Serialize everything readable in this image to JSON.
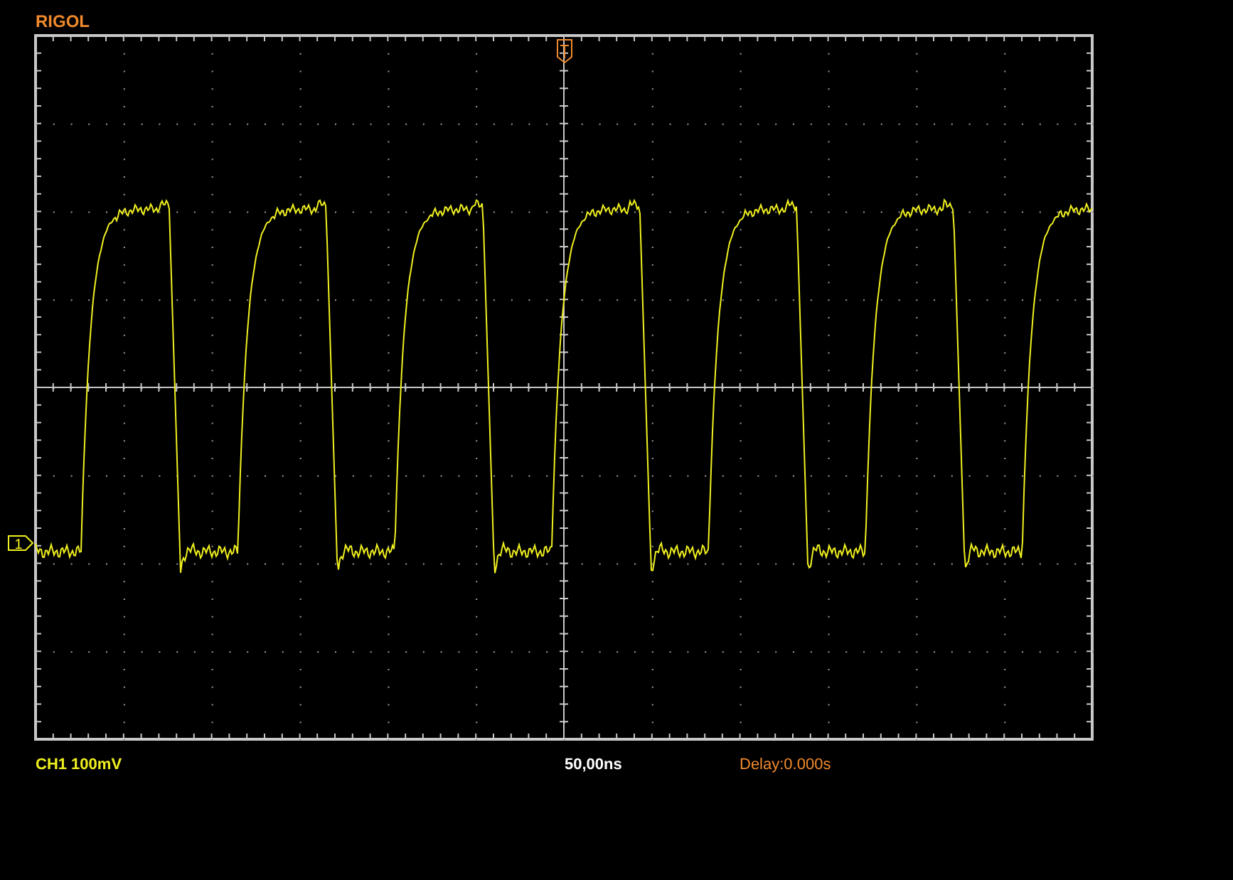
{
  "brand": "RIGOL",
  "channel_marker": "1",
  "status_bar": {
    "channel": "CH1 100mV",
    "timebase": "50,00ns",
    "delay": "Delay:0.000s"
  }
}
